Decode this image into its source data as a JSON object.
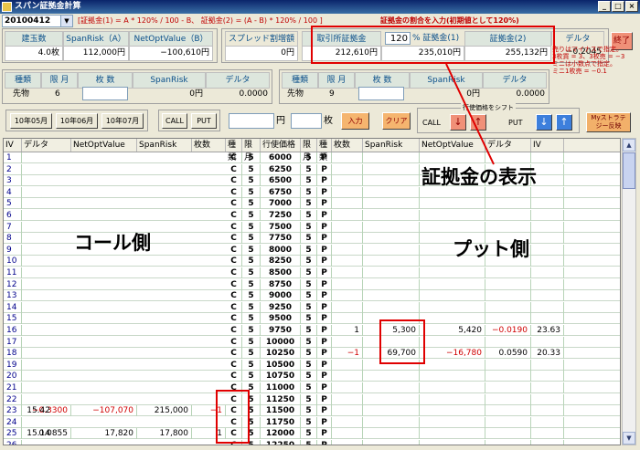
{
  "window": {
    "title": "スパン証拠金計算"
  },
  "combo_value": "20100412",
  "formula_text": "[証拠金(1) = A * 120% / 100 - B、 証拠金(2) = (A - B) * 120% / 100 ]",
  "instruction_text": "証拠金の割合を入力(初期値として120%)",
  "summary": {
    "headers": [
      "建玉数",
      "SpanRisk（A）",
      "NetOptValue（B）"
    ],
    "values": [
      "4.0枚",
      "112,000円",
      "−100,610円"
    ]
  },
  "spread": {
    "header": "スプレッド割増額",
    "value": "0円"
  },
  "margin": {
    "exchange_header": "取引所証拠金",
    "percent_value": "120",
    "margin1_header": "% 証拠金(1)",
    "margin2_header": "証拠金(2)",
    "delta_header": "デルタ",
    "exchange_value": "212,610円",
    "margin1_value": "235,010円",
    "margin2_value": "255,132円",
    "delta_value": "−0.2045"
  },
  "exit_label": "終了",
  "futures_left": {
    "headers": [
      "種類",
      "限 月",
      "枚 数",
      "SpanRisk",
      "デルタ"
    ],
    "type": "先物",
    "month": "6",
    "qty": "",
    "span": "0円",
    "delta": "0.0000"
  },
  "futures_right": {
    "headers": [
      "種類",
      "限 月",
      "枚 数",
      "SpanRisk",
      "デルタ"
    ],
    "type": "先物",
    "month": "9",
    "qty": "",
    "span": "0円",
    "delta": "0.0000"
  },
  "note_lines": [
    "売りはマイナスで指定。",
    "3枚買 = 3、3枚売 = −3",
    "ミニは小数点で指定。",
    "ミニ1枚売 = −0.1"
  ],
  "controls": {
    "month_buttons": [
      "10年05月",
      "10年06月",
      "10年07月"
    ],
    "call_label": "CALL",
    "put_label": "PUT",
    "price_unit": "円",
    "qty_unit": "枚",
    "input_label": "入力",
    "clear_label": "クリア",
    "shift_title": "行使価格をシフト",
    "shift_call": "CALL",
    "shift_put": "PUT",
    "down_arrow": "↓",
    "up_arrow": "↑",
    "my_strategy_line1": "Myストラテ",
    "my_strategy_line2": "ジー反映"
  },
  "table": {
    "headers": [
      "IV",
      "デルタ",
      "NetOptValue",
      "SpanRisk",
      "枚数",
      "種類",
      "限月",
      "行使価格",
      "限月",
      "種類",
      "枚数",
      "SpanRisk",
      "NetOptValue",
      "デルタ",
      "IV"
    ],
    "rows": [
      [
        "1",
        "",
        "",
        "",
        "",
        "C",
        "5",
        "6000",
        "5",
        "P",
        "",
        "",
        "",
        "",
        ""
      ],
      [
        "2",
        "",
        "",
        "",
        "",
        "C",
        "5",
        "6250",
        "5",
        "P",
        "",
        "",
        "",
        "",
        ""
      ],
      [
        "3",
        "",
        "",
        "",
        "",
        "C",
        "5",
        "6500",
        "5",
        "P",
        "",
        "",
        "",
        "",
        ""
      ],
      [
        "4",
        "",
        "",
        "",
        "",
        "C",
        "5",
        "6750",
        "5",
        "P",
        "",
        "",
        "",
        "",
        ""
      ],
      [
        "5",
        "",
        "",
        "",
        "",
        "C",
        "5",
        "7000",
        "5",
        "P",
        "",
        "",
        "",
        "",
        ""
      ],
      [
        "6",
        "",
        "",
        "",
        "",
        "C",
        "5",
        "7250",
        "5",
        "P",
        "",
        "",
        "",
        "",
        ""
      ],
      [
        "7",
        "",
        "",
        "",
        "",
        "C",
        "5",
        "7500",
        "5",
        "P",
        "",
        "",
        "",
        "",
        ""
      ],
      [
        "8",
        "",
        "",
        "",
        "",
        "C",
        "5",
        "7750",
        "5",
        "P",
        "",
        "",
        "",
        "",
        ""
      ],
      [
        "9",
        "",
        "",
        "",
        "",
        "C",
        "5",
        "8000",
        "5",
        "P",
        "",
        "",
        "",
        "",
        ""
      ],
      [
        "10",
        "",
        "",
        "",
        "",
        "C",
        "5",
        "8250",
        "5",
        "P",
        "",
        "",
        "",
        "",
        ""
      ],
      [
        "11",
        "",
        "",
        "",
        "",
        "C",
        "5",
        "8500",
        "5",
        "P",
        "",
        "",
        "",
        "",
        ""
      ],
      [
        "12",
        "",
        "",
        "",
        "",
        "C",
        "5",
        "8750",
        "5",
        "P",
        "",
        "",
        "",
        "",
        ""
      ],
      [
        "13",
        "",
        "",
        "",
        "",
        "C",
        "5",
        "9000",
        "5",
        "P",
        "",
        "",
        "",
        "",
        ""
      ],
      [
        "14",
        "",
        "",
        "",
        "",
        "C",
        "5",
        "9250",
        "5",
        "P",
        "",
        "",
        "",
        "",
        ""
      ],
      [
        "15",
        "",
        "",
        "",
        "",
        "C",
        "5",
        "9500",
        "5",
        "P",
        "",
        "",
        "",
        "",
        ""
      ],
      [
        "16",
        "",
        "",
        "",
        "",
        "C",
        "5",
        "9750",
        "5",
        "P",
        "1",
        "5,300",
        "5,420",
        "−0.0190",
        "23.63"
      ],
      [
        "17",
        "",
        "",
        "",
        "",
        "C",
        "5",
        "10000",
        "5",
        "P",
        "",
        "",
        "",
        "",
        ""
      ],
      [
        "18",
        "",
        "",
        "",
        "",
        "C",
        "5",
        "10250",
        "5",
        "P",
        "−1",
        "69,700",
        "−16,780",
        "0.0590",
        "20.33"
      ],
      [
        "19",
        "",
        "",
        "",
        "",
        "C",
        "5",
        "10500",
        "5",
        "P",
        "",
        "",
        "",
        "",
        ""
      ],
      [
        "20",
        "",
        "",
        "",
        "",
        "C",
        "5",
        "10750",
        "5",
        "P",
        "",
        "",
        "",
        "",
        ""
      ],
      [
        "21",
        "",
        "",
        "",
        "",
        "C",
        "5",
        "11000",
        "5",
        "P",
        "",
        "",
        "",
        "",
        ""
      ],
      [
        "22",
        "",
        "",
        "",
        "",
        "C",
        "5",
        "11250",
        "5",
        "P",
        "",
        "",
        "",
        "",
        ""
      ],
      [
        "23",
        "15.42",
        "−0.3300",
        "−107,070",
        "215,000",
        "−1",
        "C",
        "5",
        "11500",
        "5",
        "P",
        "",
        "",
        "",
        "",
        ""
      ],
      [
        "24",
        "",
        "",
        "",
        "",
        "C",
        "5",
        "11750",
        "5",
        "P",
        "",
        "",
        "",
        "",
        ""
      ],
      [
        "25",
        "15.14",
        "0.0855",
        "17,820",
        "17,800",
        "1",
        "C",
        "5",
        "12000",
        "5",
        "P",
        "",
        "",
        "",
        "",
        ""
      ],
      [
        "26",
        "",
        "",
        "",
        "",
        "C",
        "5",
        "12250",
        "5",
        "P",
        "",
        "",
        "",
        "",
        ""
      ]
    ]
  },
  "annotations": {
    "margin_label": "証拠金の表示",
    "call_side_label": "コール側",
    "put_side_label": "プット側"
  },
  "colors": {
    "accent_red": "#e00000",
    "header_blue": "#0a4f8a"
  }
}
